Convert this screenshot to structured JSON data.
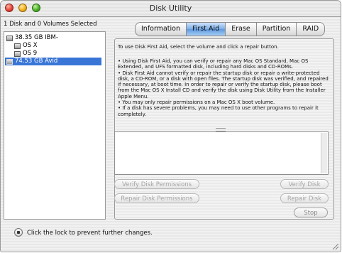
{
  "window": {
    "title": "Disk Utility"
  },
  "source_list": {
    "header": "1 Disk and 0 Volumes Selected",
    "items": [
      {
        "label": "38.35 GB IBM-"
      },
      {
        "label": "OS X"
      },
      {
        "label": "OS 9"
      },
      {
        "label": "74.53 GB Avid",
        "selected": true
      }
    ]
  },
  "tabs": [
    {
      "label": "Information"
    },
    {
      "label": "First Aid",
      "active": true
    },
    {
      "label": "Erase"
    },
    {
      "label": "Partition"
    },
    {
      "label": "RAID"
    }
  ],
  "first_aid": {
    "intro": "To use Disk First Aid, select the volume and click a repair button.",
    "bullets": [
      "• Using Disk First Aid, you can verify or repair any Mac OS Standard, Mac OS Extended, and UFS formatted disk, including hard disks and CD-ROMs.",
      "• Disk First Aid cannot verify or repair the startup disk or repair a write-protected disk, a CD-ROM, or a disk with open files.  The startup disk was verified, and repaired if necessary, at boot time.  In order to repair or verify the startup disk, please boot from the Mac OS X Install CD and verify the disk using Disk Utility from the Installer Apple Menu.",
      "• You may only repair permissions on a Mac OS X boot volume.",
      "• If a disk has severe problems, you may need to use other programs to repair it completely."
    ],
    "buttons": {
      "verify_permissions": "Verify Disk Permissions",
      "repair_permissions": "Repair Disk Permissions",
      "verify_disk": "Verify Disk",
      "repair_disk": "Repair Disk",
      "stop": "Stop"
    }
  },
  "footer": {
    "lock_message": "Click the lock to prevent further changes."
  }
}
